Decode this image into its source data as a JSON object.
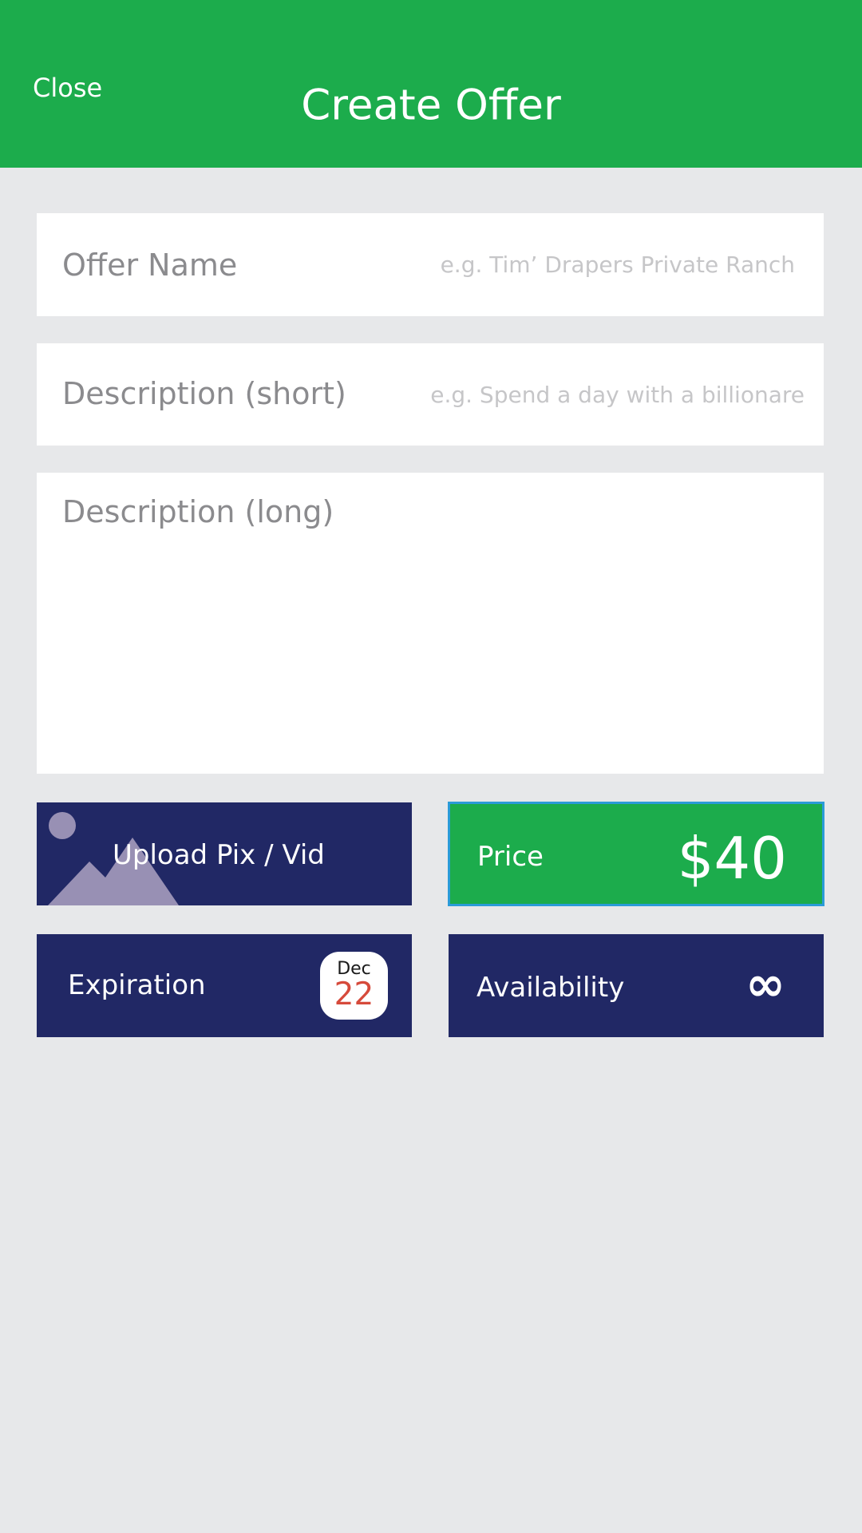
{
  "header": {
    "close_label": "Close",
    "title": "Create Offer",
    "background_color": "#1cac4c"
  },
  "form": {
    "offer_name": {
      "label": "Offer Name",
      "placeholder": "e.g. Tim’ Drapers Private Ranch"
    },
    "description_short": {
      "label": "Description (short)",
      "placeholder": "e.g. Spend a day with a billionare"
    },
    "description_long": {
      "label": "Description (long)"
    }
  },
  "tiles": {
    "upload": {
      "label": "Upload Pix / Vid",
      "icon": "image-placeholder-icon"
    },
    "price": {
      "label": "Price",
      "value": "$40",
      "color": "#1cac4c"
    },
    "expiration": {
      "label": "Expiration",
      "month": "Dec",
      "day": "22",
      "icon": "calendar-icon"
    },
    "availability": {
      "label": "Availability",
      "value": "∞",
      "icon": "infinity-icon"
    }
  },
  "colors": {
    "navy": "#212865",
    "background": "#e7e8ea",
    "accent_border": "#2b9bd8"
  }
}
